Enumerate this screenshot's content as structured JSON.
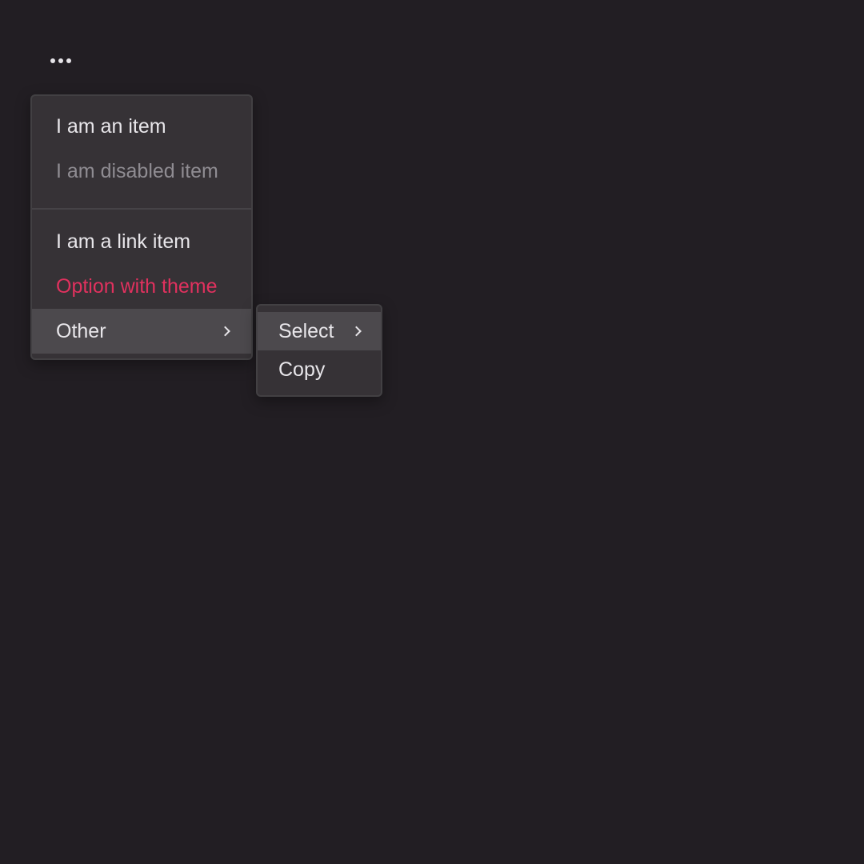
{
  "trigger": {
    "icon": "more-horizontal-icon"
  },
  "menu": {
    "items": [
      {
        "label": "I am an item",
        "state": "normal"
      },
      {
        "label": "I am disabled item",
        "state": "disabled"
      },
      {
        "label": "I am a link item",
        "state": "link"
      },
      {
        "label": "Option with theme",
        "state": "theme"
      },
      {
        "label": "Other",
        "state": "active",
        "has_submenu": true
      }
    ]
  },
  "submenu": {
    "items": [
      {
        "label": "Select",
        "state": "active",
        "has_submenu": true
      },
      {
        "label": "Copy",
        "state": "normal"
      }
    ]
  },
  "colors": {
    "background": "#221e23",
    "menu_bg": "#363236",
    "active_bg": "#4c494d",
    "text": "#e8e6ea",
    "disabled_text": "#8f8c92",
    "theme": "#e0315e"
  }
}
